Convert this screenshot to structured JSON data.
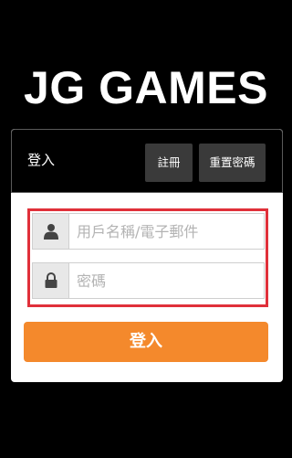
{
  "logo": {
    "text": "JG GAMES"
  },
  "header": {
    "title": "登入",
    "register_label": "註冊",
    "reset_password_label": "重置密碼"
  },
  "form": {
    "username": {
      "placeholder": "用戶名稱/電子郵件",
      "value": "",
      "icon": "user-icon"
    },
    "password": {
      "placeholder": "密碼",
      "value": "",
      "icon": "lock-icon"
    },
    "submit_label": "登入"
  },
  "colors": {
    "background": "#000000",
    "tab_button": "#3a3a3a",
    "highlight_border": "#e0303a",
    "login_button": "#f4892c",
    "icon_bg": "#e8e8e8"
  }
}
